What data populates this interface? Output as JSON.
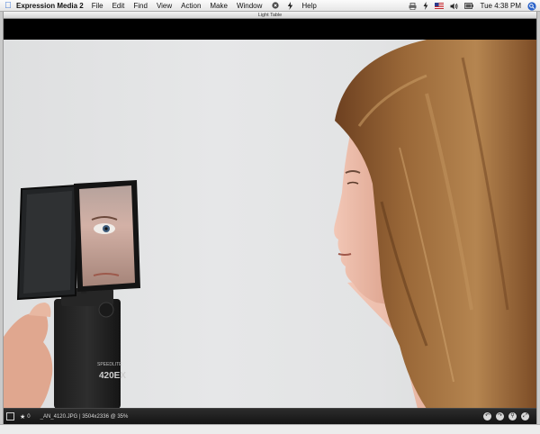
{
  "menubar": {
    "app_name": "Expression Media 2",
    "items": [
      "File",
      "Edit",
      "Find",
      "View",
      "Action",
      "Make",
      "Window"
    ],
    "help_label": "Help",
    "clock": "Tue 4:38 PM"
  },
  "window": {
    "title": "Light Table"
  },
  "photo": {
    "filename_label": "_AN_4120.JPG",
    "flash_model_text": "420EX",
    "flash_brand_text": "SPEEDLITE"
  },
  "statusbar": {
    "rating_value": "0",
    "file_info": "_AN_4120.JPG | 3504x2336 @ 35%",
    "tools": [
      "rotate-left-icon",
      "rotate-right-icon",
      "zoom-icon",
      "fullscreen-icon"
    ]
  },
  "colors": {
    "apple_blue": "#1a5fd0",
    "background_wall": "#e3e4e5",
    "hair": "#8a5a2e",
    "skin": "#e9b7a4",
    "viewer_black": "#000000"
  }
}
